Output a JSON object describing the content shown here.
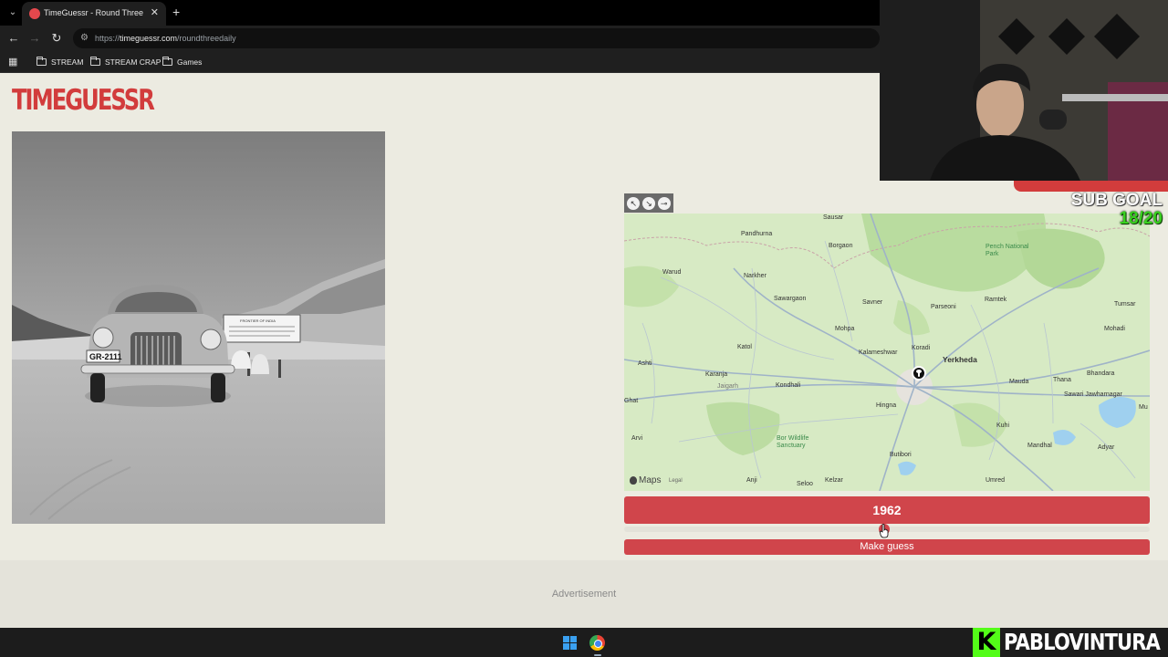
{
  "browser": {
    "tab_title": "TimeGuessr - Round Three",
    "tab_close": "✕",
    "new_tab": "+",
    "url_scheme": "https://",
    "url_host": "timeguessr.com",
    "url_path": "/roundthreedaily",
    "bookmarks": [
      "STREAM",
      "STREAM CRAP",
      "Games"
    ]
  },
  "page": {
    "logo": "TIMEGUESSR",
    "photo": {
      "plate": "GR-2111",
      "sign_heading": "FRONTIER OF INDIA"
    },
    "map": {
      "places": [
        {
          "name": "Sausar",
          "big": false
        },
        {
          "name": "Pandhurna",
          "big": false
        },
        {
          "name": "Borgaon",
          "big": false
        },
        {
          "name": "Pench National Park",
          "big": false
        },
        {
          "name": "Warud",
          "big": false
        },
        {
          "name": "Narkher",
          "big": false
        },
        {
          "name": "Savner",
          "big": false
        },
        {
          "name": "Parseoni",
          "big": false
        },
        {
          "name": "Ramtek",
          "big": false
        },
        {
          "name": "Tumsar",
          "big": false
        },
        {
          "name": "Sawargaon",
          "big": false
        },
        {
          "name": "Mohpa",
          "big": false
        },
        {
          "name": "Mohadi",
          "big": false
        },
        {
          "name": "Katol",
          "big": false
        },
        {
          "name": "Kalameshwar",
          "big": false
        },
        {
          "name": "Koradi",
          "big": false
        },
        {
          "name": "Yerkheda",
          "big": true
        },
        {
          "name": "Ashti",
          "big": false
        },
        {
          "name": "Karanja",
          "big": false
        },
        {
          "name": "Mauda",
          "big": false
        },
        {
          "name": "Thana",
          "big": false
        },
        {
          "name": "Bhandara",
          "big": false
        },
        {
          "name": "Jaigarh",
          "big": false
        },
        {
          "name": "Kondhali",
          "big": false
        },
        {
          "name": "Sawari Jawharnagar",
          "big": false
        },
        {
          "name": "Hingna",
          "big": false
        },
        {
          "name": "Ghat",
          "big": false
        },
        {
          "name": "Mu",
          "big": false
        },
        {
          "name": "Kuhi",
          "big": false
        },
        {
          "name": "Arvi",
          "big": false
        },
        {
          "name": "Bor Wildlife Sanctuary",
          "big": false
        },
        {
          "name": "Mandhal",
          "big": false
        },
        {
          "name": "Adyar",
          "big": false
        },
        {
          "name": "Butibori",
          "big": false
        },
        {
          "name": "Anji",
          "big": false
        },
        {
          "name": "Kelzar",
          "big": false
        },
        {
          "name": "Seloo",
          "big": false
        },
        {
          "name": "Umred",
          "big": false
        }
      ],
      "brand": "Maps",
      "legal": "Legal"
    },
    "year": "1962",
    "year_slider_position": 0.495,
    "make_guess": "Make guess",
    "advertisement": "Advertisement"
  },
  "overlay": {
    "sub_goal_label": "SUB GOAL",
    "sub_goal_count": "18/20",
    "streamer": "PABLOVINTURA",
    "platform_badge": "K"
  },
  "colors": {
    "accent": "#d0454b",
    "page_bg": "#ecebe1",
    "goal_green": "#39d01f",
    "kick_green": "#53fc18"
  }
}
